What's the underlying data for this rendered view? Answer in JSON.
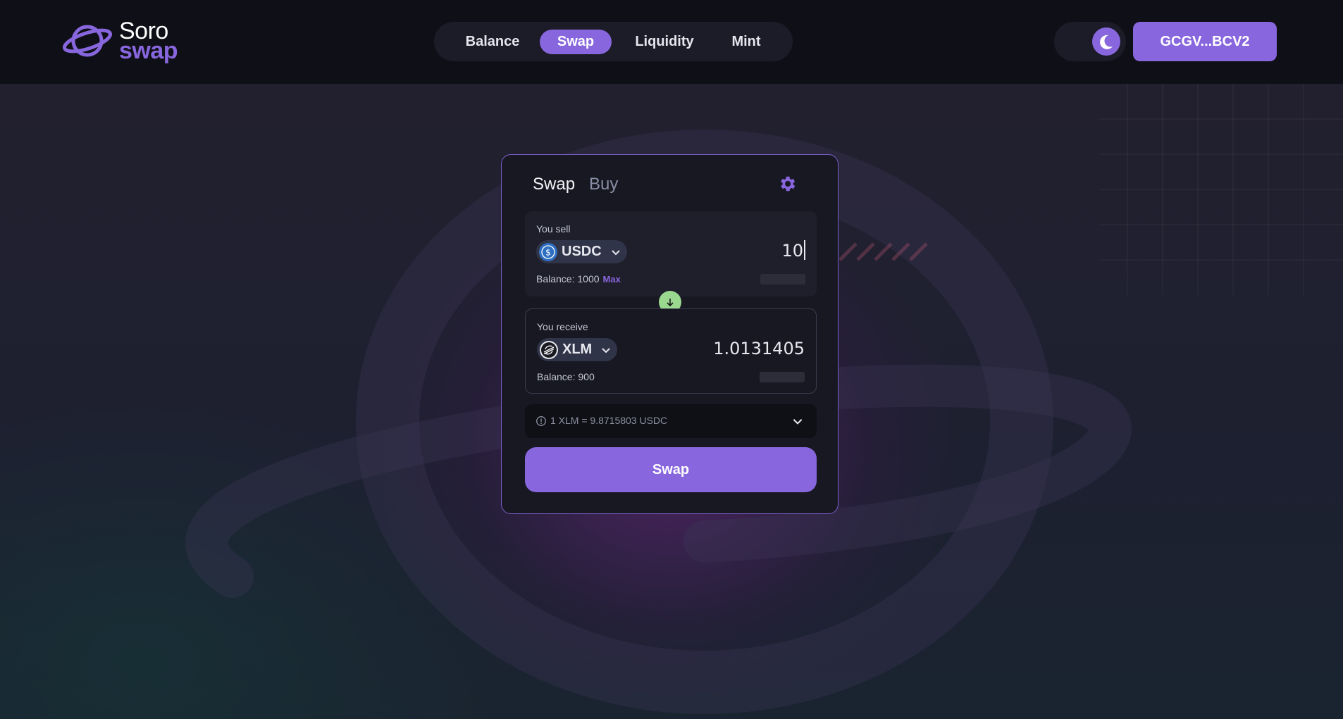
{
  "logo": {
    "line1": "Soro",
    "line2": "swap"
  },
  "nav": {
    "items": [
      {
        "label": "Balance",
        "active": false
      },
      {
        "label": "Swap",
        "active": true
      },
      {
        "label": "Liquidity",
        "active": false
      },
      {
        "label": "Mint",
        "active": false
      }
    ]
  },
  "header": {
    "theme_icon": "moon-icon",
    "wallet_address": "GCGV...BCV2"
  },
  "swap_card": {
    "tabs": [
      {
        "label": "Swap",
        "active": true
      },
      {
        "label": "Buy",
        "active": false
      }
    ],
    "settings_icon": "gear-icon",
    "sell": {
      "label": "You sell",
      "token": "USDC",
      "token_icon": "usdc-icon",
      "amount": "10",
      "balance_text": "Balance: 1000",
      "max_label": "Max"
    },
    "receive": {
      "label": "You receive",
      "token": "XLM",
      "token_icon": "stellar-icon",
      "amount": "1.0131405",
      "balance_text": "Balance: 900"
    },
    "rate_text": "1 XLM = 9.8715803 USDC",
    "swap_button": "Swap"
  },
  "colors": {
    "accent": "#8866dd",
    "flip_button": "#9ad88f",
    "header_bg": "#0f1017",
    "card_bg": "#171822"
  }
}
